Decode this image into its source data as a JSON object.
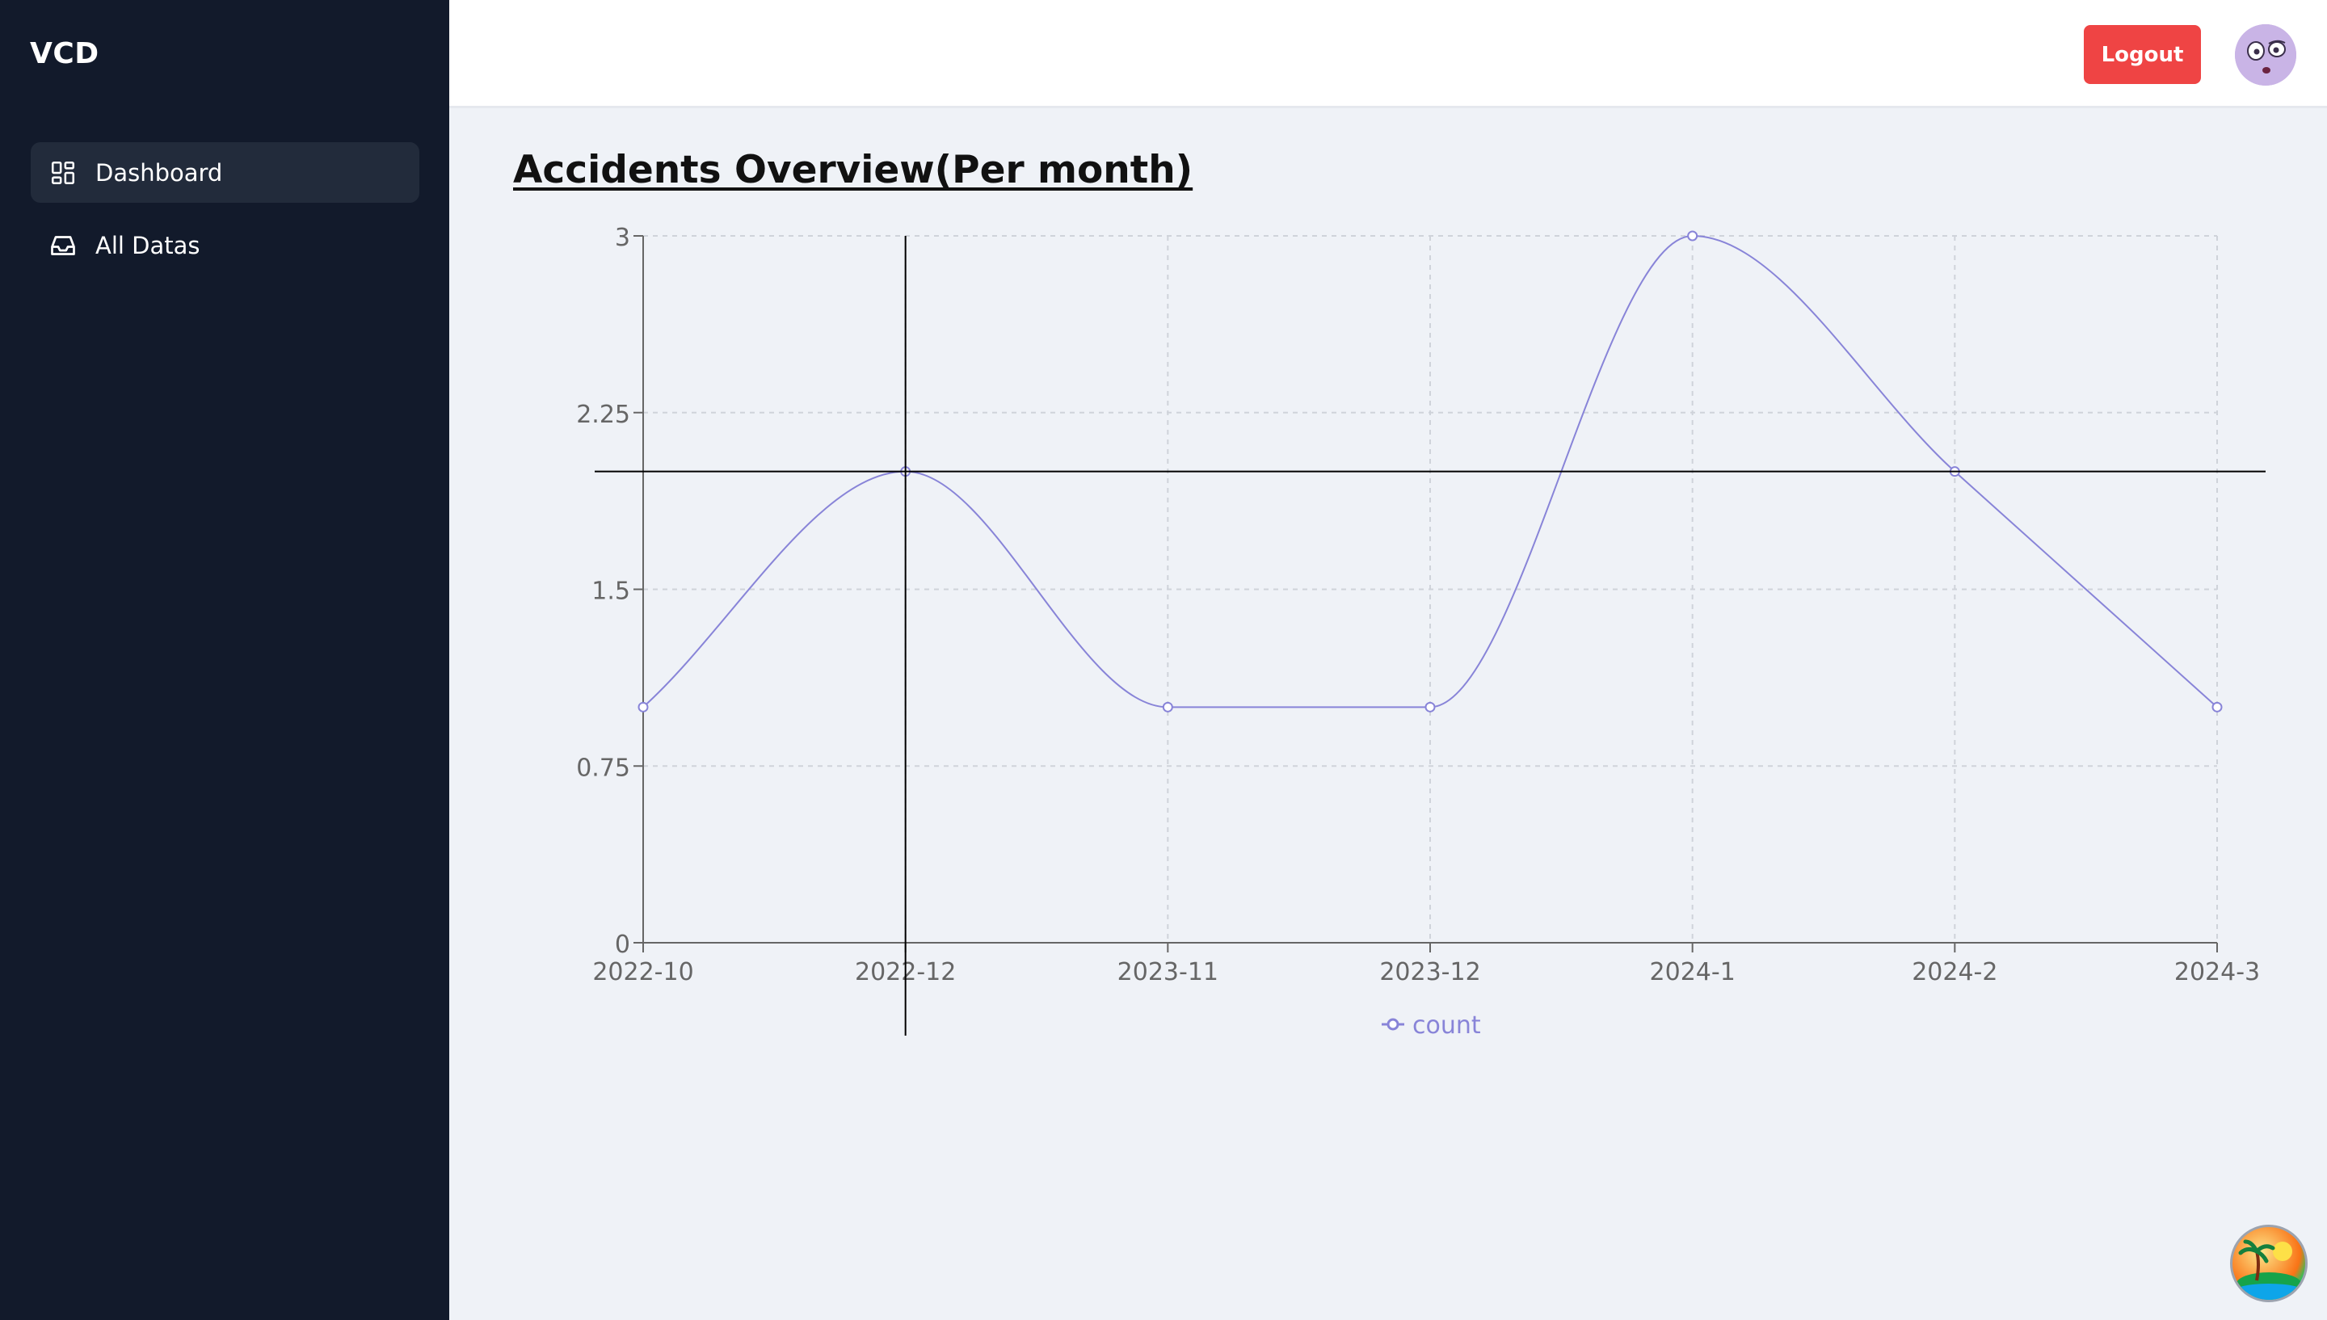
{
  "app": {
    "brand": "VCD"
  },
  "sidebar": {
    "items": [
      {
        "label": "Dashboard",
        "icon": "dashboard-grid-icon",
        "active": true
      },
      {
        "label": "All Datas",
        "icon": "inbox-tray-icon",
        "active": false
      }
    ]
  },
  "header": {
    "logout_label": "Logout",
    "avatar_icon": "avatar-face-icon"
  },
  "page": {
    "title": "Accidents Overview(Per month)"
  },
  "colors": {
    "sidebar_bg": "#121a2b",
    "logout_bg": "#ef4444",
    "series": "#8884d8",
    "page_bg": "#eff2f7"
  },
  "chart_data": {
    "type": "line",
    "categories": [
      "2022-10",
      "2022-12",
      "2023-11",
      "2023-12",
      "2024-1",
      "2024-2",
      "2024-3"
    ],
    "series": [
      {
        "name": "count",
        "values": [
          1,
          2,
          1,
          1,
          3,
          2,
          1
        ]
      }
    ],
    "yticks": [
      "0",
      "0.75",
      "1.5",
      "2.25",
      "3"
    ],
    "ylim": [
      0,
      3
    ],
    "grid": true,
    "legend": "bottom",
    "crosshair": {
      "category": "2022-12",
      "value": 2
    }
  },
  "fab": {
    "icon": "island-sunset-icon"
  }
}
